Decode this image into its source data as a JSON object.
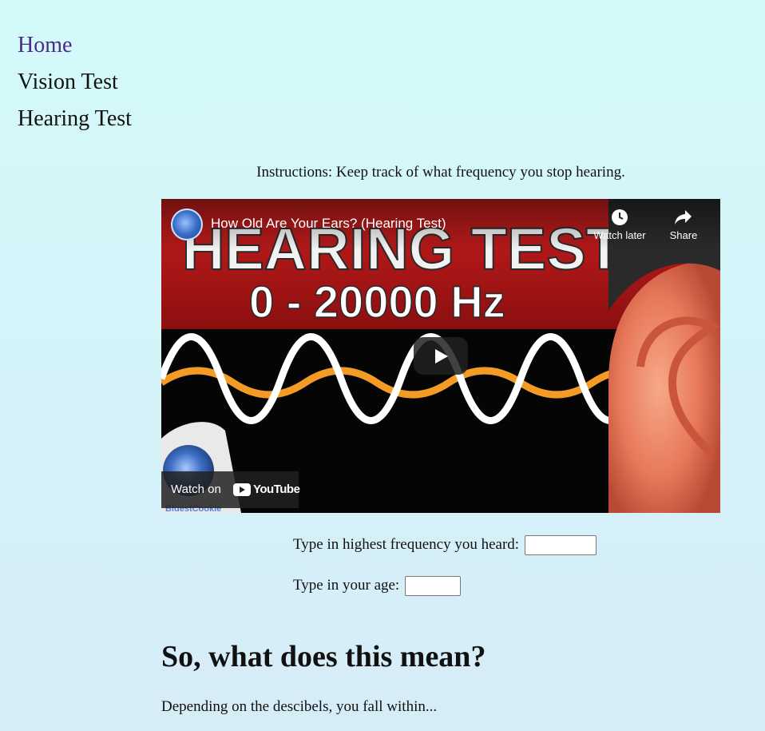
{
  "nav": {
    "home": "Home",
    "vision": "Vision Test",
    "hearing": "Hearing Test"
  },
  "instructions": "Instructions: Keep track of what frequency you stop hearing.",
  "video": {
    "title": "How Old Are Your Ears? (Hearing Test)",
    "thumb_heading": "HEARING TEST",
    "thumb_range": "0 - 20000 Hz",
    "watch_later": "Watch later",
    "share": "Share",
    "watch_on": "Watch on",
    "youtube": "YouTube",
    "channel": "BluestCookie"
  },
  "form": {
    "freq_label": "Type in highest frequency you heard:",
    "freq_value": "",
    "age_label": "Type in your age:",
    "age_value": ""
  },
  "section": {
    "heading": "So, what does this mean?",
    "text": "Depending on the descibels, you fall within..."
  }
}
